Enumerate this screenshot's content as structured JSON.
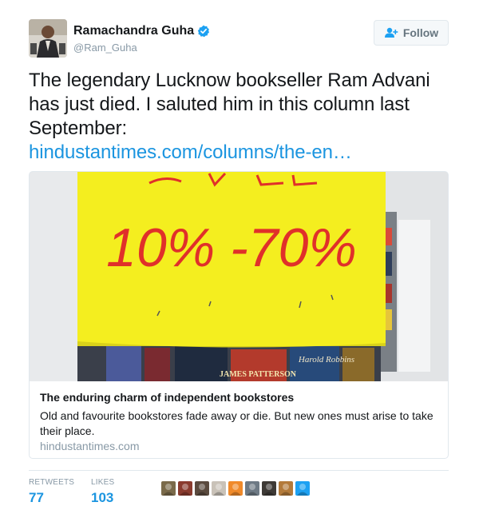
{
  "author": {
    "display_name": "Ramachandra Guha",
    "handle": "@Ram_Guha",
    "verified": true
  },
  "follow": {
    "label": "Follow",
    "icon": "follow-person-plus-icon"
  },
  "tweet": {
    "lines": [
      "The legendary Lucknow bookseller Ram Advani",
      "has just died. I saluted him in this column last",
      "September:"
    ],
    "link_text": "hindustantimes.com/columns/the-en…"
  },
  "card": {
    "image": {
      "sign_text": "10% -70%",
      "book_labels": [
        "Harold Robbins",
        "JAMES PATTERSON"
      ],
      "sign_color": "#f4ee1f",
      "ink_color": "#e0302a"
    },
    "title": "The enduring charm of independent bookstores",
    "description": "Old and favourite bookstores fade away or die. But new ones must arise to take their place.",
    "domain": "hindustantimes.com"
  },
  "stats": {
    "retweets_label": "RETWEETS",
    "retweets": "77",
    "likes_label": "LIKES",
    "likes": "103"
  },
  "likers": [
    {
      "color": "#7a6a4a"
    },
    {
      "color": "#8a3b2e"
    },
    {
      "color": "#5a4a3e"
    },
    {
      "color": "#c9c2b8"
    },
    {
      "color": "#f08a2a"
    },
    {
      "color": "#6e7a85"
    },
    {
      "color": "#3e3a36"
    },
    {
      "color": "#b37a3a"
    },
    {
      "color": "#1da1f2"
    }
  ],
  "colors": {
    "link": "#1b95e0",
    "muted": "#8899a6",
    "verified": "#1da1f2"
  }
}
